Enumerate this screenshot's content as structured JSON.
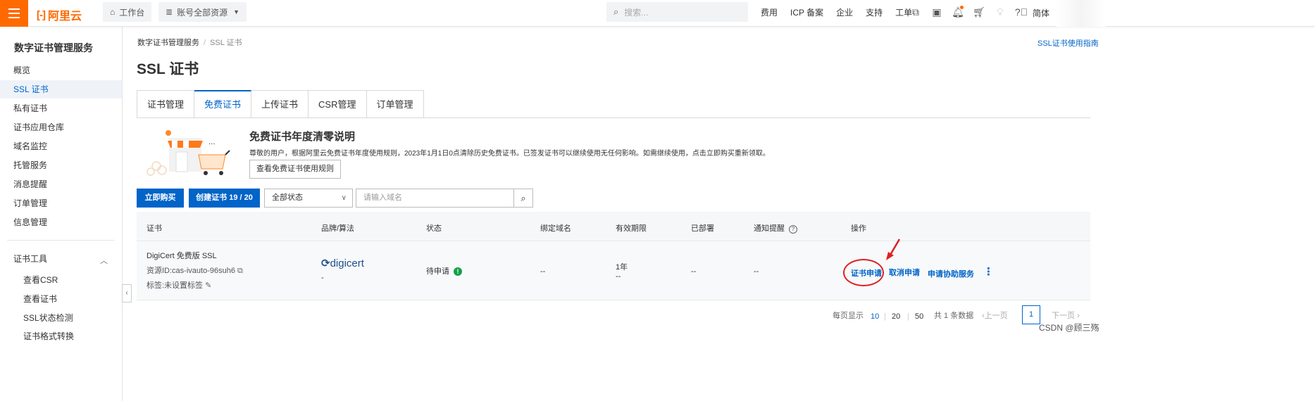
{
  "topbar": {
    "logo_text": "阿里云",
    "workbench_label": "工作台",
    "resources_label": "账号全部资源",
    "search_placeholder": "搜索...",
    "links": [
      "费用",
      "ICP 备案",
      "企业",
      "支持",
      "工单"
    ],
    "lang_label": "简体",
    "accent_color": "#ff6a00"
  },
  "sidebar": {
    "title": "数字证书管理服务",
    "items": [
      {
        "label": "概览"
      },
      {
        "label": "SSL 证书"
      },
      {
        "label": "私有证书"
      },
      {
        "label": "证书应用仓库"
      },
      {
        "label": "域名监控"
      },
      {
        "label": "托管服务"
      },
      {
        "label": "消息提醒"
      },
      {
        "label": "订单管理"
      },
      {
        "label": "信息管理"
      }
    ],
    "tools_label": "证书工具",
    "tools": [
      "查看CSR",
      "查看证书",
      "SSL状态检测",
      "证书格式转换"
    ]
  },
  "breadcrumb": {
    "root": "数字证书管理服务",
    "current": "SSL 证书"
  },
  "guide_link": "SSL证书使用指南",
  "page_title": "SSL 证书",
  "tabs": [
    "证书管理",
    "免费证书",
    "上传证书",
    "CSR管理",
    "订单管理"
  ],
  "notice": {
    "title": "免费证书年度清零说明",
    "text": "尊敬的用户，根据阿里云免费证书年度使用规则，2023年1月1日0点清除历史免费证书。已签发证书可以继续使用无任何影响。如需继续使用，点击立即购买重新领取。",
    "button": "查看免费证书使用规则"
  },
  "toolbar": {
    "buy_label": "立即购买",
    "create_label": "创建证书 19 / 20",
    "status_select": "全部状态",
    "domain_placeholder": "请输入域名"
  },
  "table": {
    "headers": [
      "证书",
      "品牌/算法",
      "状态",
      "绑定域名",
      "有效期限",
      "已部署",
      "通知提醒",
      "操作"
    ],
    "rows": [
      {
        "name": "DigiCert 免费版 SSL",
        "resource_id": "资源ID:cas-ivauto-96suh6",
        "tag": "标签:未设置标签",
        "brand": "digicert",
        "brand_sub": "-",
        "status": "待申请",
        "domain": "--",
        "period": "1年",
        "period_sub": "--",
        "deployed": "--",
        "notify": "--",
        "actions": [
          "证书申请",
          "取消申请",
          "申请协助服务"
        ]
      }
    ]
  },
  "pagination": {
    "per_page_label": "每页显示",
    "sizes": [
      "10",
      "20",
      "50"
    ],
    "total": "共 1 条数据",
    "prev": "上一页",
    "current": "1",
    "next": "下一页"
  },
  "watermark": "CSDN @顾三殇"
}
